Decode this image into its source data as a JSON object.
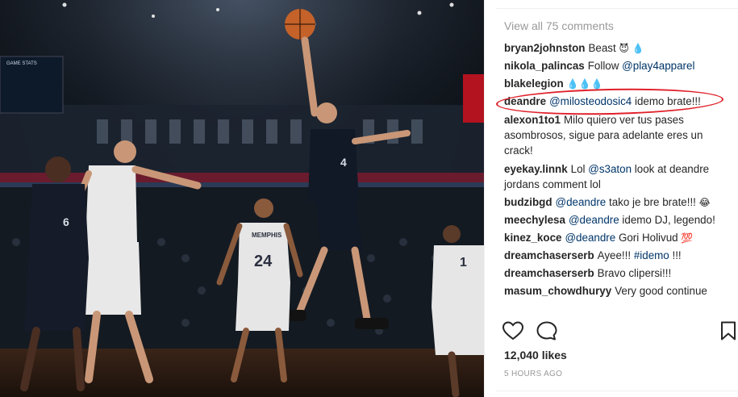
{
  "post": {
    "view_all_comments": "View all 75 comments",
    "comments": [
      {
        "user": "bryan2johnston",
        "text": "Beast",
        "emoji": "😈 💧"
      },
      {
        "user": "nikola_palincas",
        "text": "Follow ",
        "mention": "@play4apparel",
        "after": ""
      },
      {
        "user": "blakelegion",
        "text": "",
        "emoji": "💧💧💧"
      },
      {
        "user": "deandre",
        "text": "",
        "mention": "@milosteodosic4",
        "after": " idemo brate!!!"
      },
      {
        "user": "alexon1to1",
        "text": "Milo quiero ver tus pases asombrosos, sigue para adelante eres un crack!"
      },
      {
        "user": "eyekay.linnk",
        "text": "Lol ",
        "mention": "@s3aton",
        "after": " look at deandre jordans comment lol"
      },
      {
        "user": "budzibgd",
        "text": "",
        "mention": "@deandre",
        "after": " tako je bre brate!!! ",
        "emoji": "😂"
      },
      {
        "user": "meechylesa",
        "text": "",
        "mention": "@deandre",
        "after": " idemo DJ, legendo!"
      },
      {
        "user": "kinez_koce",
        "text": "",
        "mention": "@deandre",
        "after": " Gori Holivud ",
        "emoji": "💯"
      },
      {
        "user": "dreamchaserserb",
        "text": "Ayee!!! ",
        "mention": "#idemo",
        "after": " !!!"
      },
      {
        "user": "dreamchaserserb",
        "text": "Bravo clipersi!!!"
      },
      {
        "user": "masum_chowdhuryy",
        "text": "Very good continue"
      }
    ],
    "likes": "12,040 likes",
    "timestamp": "5 HOURS AGO"
  },
  "photo": {
    "jersey_numbers": [
      "4",
      "24",
      "1",
      "6"
    ],
    "jersey_team_text": "MEMPHIS",
    "arena_sign": "GAME STATS"
  },
  "icons": {
    "like": "heart-outline-icon",
    "comment": "speech-bubble-icon",
    "save": "bookmark-icon"
  },
  "colors": {
    "mention": "#003569",
    "muted": "#999999",
    "highlight": "#e0202a"
  }
}
